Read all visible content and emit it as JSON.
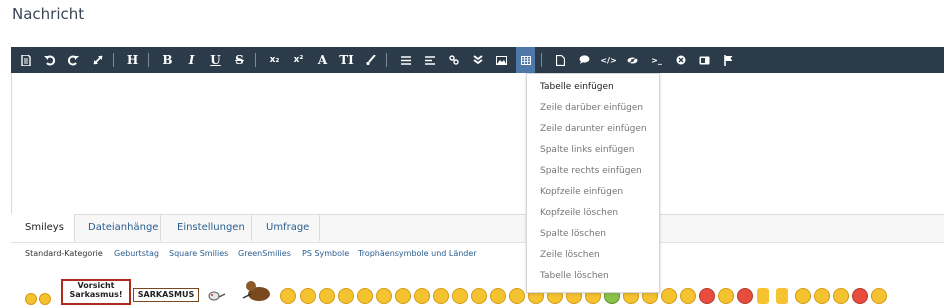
{
  "title": "Nachricht",
  "toolbar": {
    "heading_label": "H",
    "bold_label": "B",
    "italic_label": "I",
    "underline_label": "U",
    "strike_label": "S",
    "subscript_label": "x₂",
    "superscript_label": "x²",
    "font_label": "A",
    "fontsize_label": "TI",
    "code_label": "</>",
    "terminal_label": ">_"
  },
  "table_menu": {
    "items": [
      {
        "label": "Tabelle einfügen"
      },
      {
        "label": "Zeile darüber einfügen"
      },
      {
        "label": "Zeile darunter einfügen"
      },
      {
        "label": "Spalte links einfügen"
      },
      {
        "label": "Spalte rechts einfügen"
      },
      {
        "label": "Kopfzeile einfügen"
      },
      {
        "label": "Kopfzeile löschen"
      },
      {
        "label": "Spalte löschen"
      },
      {
        "label": "Zeile löschen"
      },
      {
        "label": "Tabelle löschen"
      }
    ]
  },
  "tabs": {
    "items": [
      {
        "label": "Smileys"
      },
      {
        "label": "Dateianhänge"
      },
      {
        "label": "Einstellungen"
      },
      {
        "label": "Umfrage"
      }
    ]
  },
  "categories": {
    "items": [
      {
        "label": "Standard-Kategorie"
      },
      {
        "label": "Geburtstag"
      },
      {
        "label": "Square Smilies"
      },
      {
        "label": "GreenSmilies"
      },
      {
        "label": "PS Symbole"
      },
      {
        "label": "Trophäensymbole und Länder"
      }
    ]
  },
  "smileys": {
    "sign_vorsicht_line1": "Vorsicht",
    "sign_vorsicht_line2": "Sarkasmus!",
    "sign_sarkasmus": "SARKASMUS"
  },
  "colors": {
    "toolbar_bg": "#2c3b4a",
    "toolbar_active": "#4d78a8",
    "link": "#2a5d8f"
  }
}
